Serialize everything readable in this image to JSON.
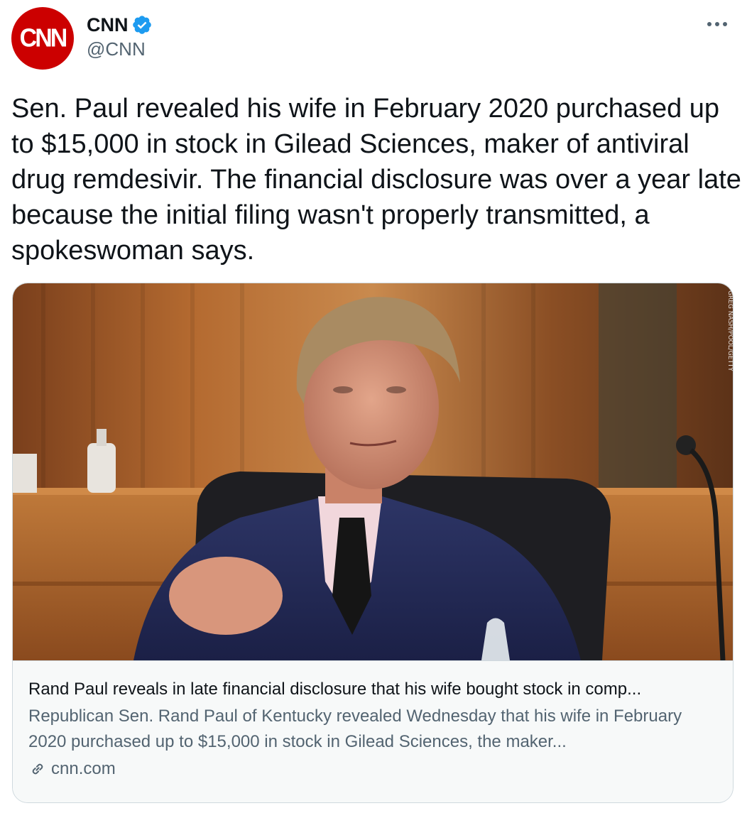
{
  "author": {
    "avatar_text": "CNN",
    "display_name": "CNN",
    "handle": "@CNN",
    "verified": true
  },
  "tweet": {
    "text": "Sen. Paul revealed his wife in February 2020 purchased up to $15,000 in stock in Gilead Sciences, maker of antiviral drug remdesivir. The financial disclosure was over a year late because the initial filing wasn't properly transmitted, a spokeswoman says."
  },
  "card": {
    "image_credit": "GREG NASH/POOL/GETTY",
    "title": "Rand Paul reveals in late financial disclosure that his wife bought stock in comp...",
    "description": "Republican Sen. Rand Paul of Kentucky revealed Wednesday that his wife in February 2020 purchased up to $15,000 in stock in Gilead Sciences, the maker...",
    "domain": "cnn.com"
  },
  "icons": {
    "verified": "verified-badge-icon",
    "more": "more-options-icon",
    "link": "link-icon"
  },
  "colors": {
    "brand_red": "#cc0000",
    "verified_blue": "#1d9bf0",
    "text_primary": "#0f1419",
    "text_secondary": "#536471",
    "border": "#cfd9de"
  }
}
